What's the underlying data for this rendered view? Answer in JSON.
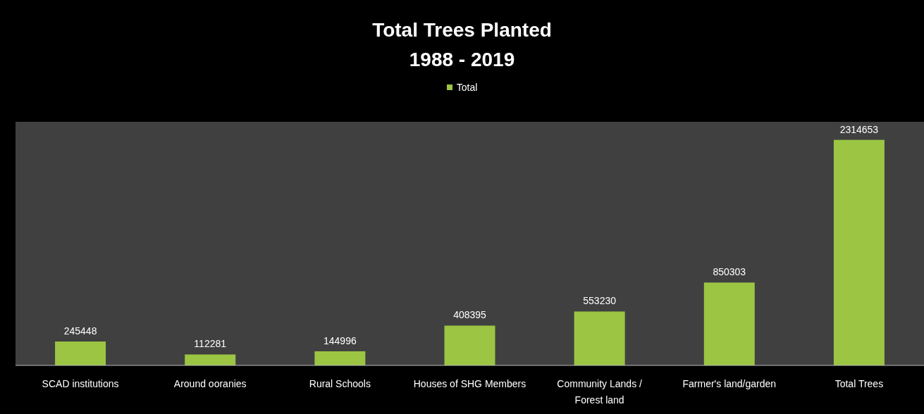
{
  "chart": {
    "chart_data": {
      "type": "bar",
      "title": "Total Trees Planted\n1988 - 2019",
      "categories": [
        "SCAD institutions",
        "Around ooranies",
        "Rural Schools",
        "Houses of SHG Members",
        "Community Lands / Forest land",
        "Farmer's land/garden",
        "Total Trees"
      ],
      "series": [
        {
          "name": "Total",
          "color": "#9bc543",
          "values": [
            245448,
            112281,
            144996,
            408395,
            553230,
            850303,
            2314653
          ]
        }
      ],
      "ylim": [
        0,
        2500000
      ],
      "data_labels": true
    }
  }
}
